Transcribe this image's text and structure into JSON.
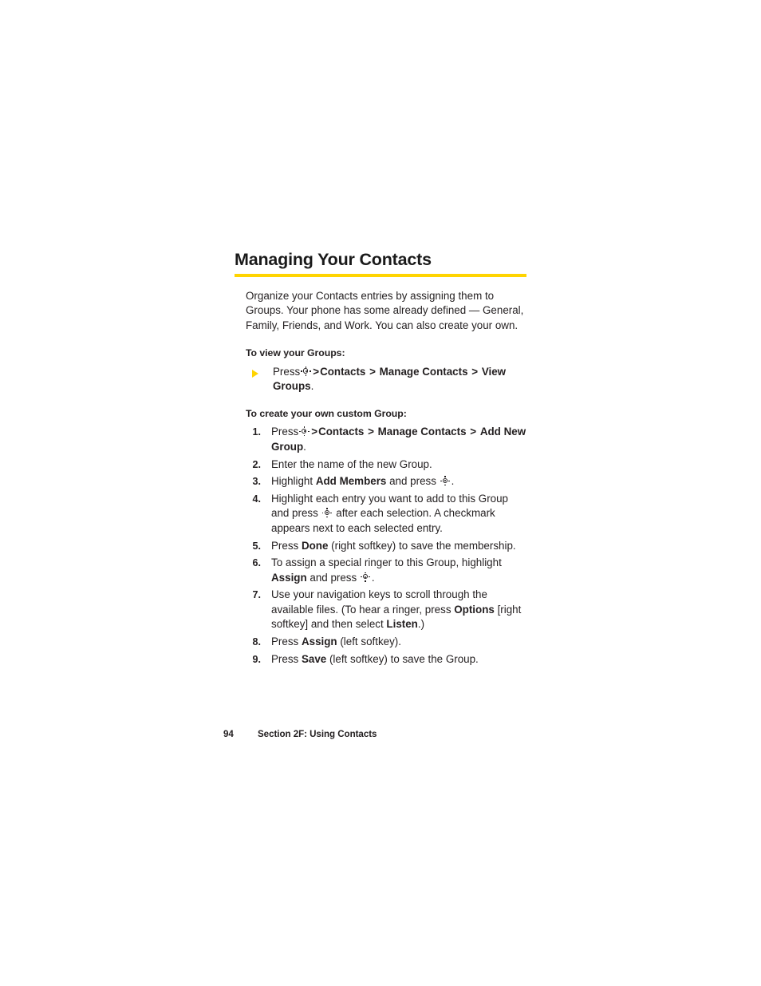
{
  "page": {
    "accent_color": "#ffd400",
    "text_color": "#231f20",
    "background_color": "#ffffff"
  },
  "heading": {
    "title": "Managing Your Contacts"
  },
  "intro": {
    "paragraph": "Organize your Contacts entries by assigning them to Groups. Your phone has some already defined — General, Family, Friends, and Work. You can also create your own."
  },
  "view_groups": {
    "subheading": "To view your Groups:",
    "bullet": {
      "icon": "triangle-bullet-icon",
      "press_label": "Press",
      "key_icon": "navigation-key-icon",
      "separator": ">",
      "menu_path": [
        "Contacts",
        "Manage Contacts",
        "View Groups"
      ],
      "period": "."
    }
  },
  "create_group": {
    "subheading": "To create your own custom Group:",
    "steps": [
      {
        "number": "1.",
        "press_label": "Press",
        "key_icon": "navigation-key-icon",
        "separator": ">",
        "menu_path": [
          "Contacts",
          "Manage Contacts",
          "Add New Group"
        ],
        "period": ".",
        "text": "Press  > Contacts > Manage Contacts > Add New Group."
      },
      {
        "number": "2.",
        "text": "Enter the name of the new Group."
      },
      {
        "number": "3.",
        "part1": "Highlight ",
        "bold1": "Add Members",
        "part2": " and press ",
        "key_icon": "navigation-key-icon",
        "part3": ".",
        "text": "Highlight Add Members and press ."
      },
      {
        "number": "4.",
        "part1": "Highlight each entry you want to add to this Group and press ",
        "key_icon": "navigation-key-icon",
        "part2": " after each selection. A checkmark appears next to each selected entry.",
        "text": "Highlight each entry you want to add to this Group and press  after each selection. A checkmark appears next to each selected entry."
      },
      {
        "number": "5.",
        "part1": "Press ",
        "bold1": "Done",
        "part2": " (right softkey) to save the membership.",
        "text": "Press Done (right softkey) to save the membership."
      },
      {
        "number": "6.",
        "part1": "To assign a special ringer to this Group, highlight ",
        "bold1": "Assign",
        "part2": " and press ",
        "key_icon": "navigation-key-icon",
        "part3": ".",
        "text": "To assign a special ringer to this Group, highlight Assign and press ."
      },
      {
        "number": "7.",
        "part1": "Use your navigation keys to scroll through the available files. (To hear a ringer, press ",
        "bold1": "Options",
        "part2": " [right softkey] and then select ",
        "bold2": "Listen",
        "part3": ".)",
        "text": "Use your navigation keys to scroll through the available files. (To hear a ringer, press Options [right softkey] and then select Listen.)"
      },
      {
        "number": "8.",
        "part1": "Press ",
        "bold1": "Assign",
        "part2": " (left softkey).",
        "text": "Press Assign (left softkey)."
      },
      {
        "number": "9.",
        "part1": "Press ",
        "bold1": "Save",
        "part2": " (left softkey) to save the Group.",
        "text": "Press Save (left softkey) to save the Group."
      }
    ]
  },
  "footer": {
    "page_number": "94",
    "section_label": "Section 2F: Using Contacts"
  }
}
